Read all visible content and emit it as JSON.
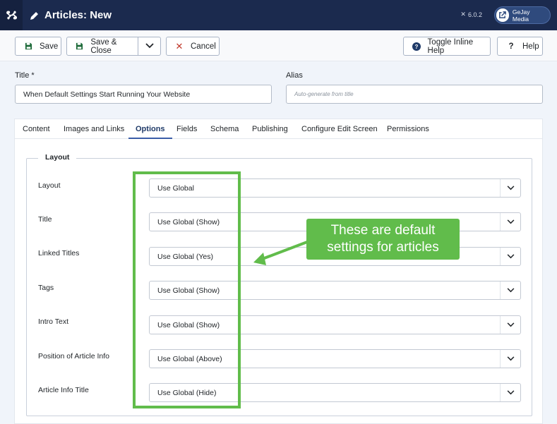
{
  "header": {
    "title": "Articles: New",
    "version": "6.0.2",
    "site_button": "GeJay Media"
  },
  "toolbar": {
    "save": "Save",
    "save_close": "Save & Close",
    "cancel": "Cancel",
    "toggle_help": "Toggle Inline Help",
    "help": "Help"
  },
  "form": {
    "title_label": "Title *",
    "title_value": "When Default Settings Start Running Your Website",
    "alias_label": "Alias",
    "alias_placeholder": "Auto-generate from title"
  },
  "tabs": [
    "Content",
    "Images and Links",
    "Options",
    "Fields",
    "Schema",
    "Publishing",
    "Configure Edit Screen",
    "Permissions"
  ],
  "active_tab": "Options",
  "fieldset": {
    "legend": "Layout",
    "rows": [
      {
        "label": "Layout",
        "value": "Use Global"
      },
      {
        "label": "Title",
        "value": "Use Global (Show)"
      },
      {
        "label": "Linked Titles",
        "value": "Use Global (Yes)"
      },
      {
        "label": "Tags",
        "value": "Use Global (Show)"
      },
      {
        "label": "Intro Text",
        "value": "Use Global (Show)"
      },
      {
        "label": "Position of Article Info",
        "value": "Use Global (Above)"
      },
      {
        "label": "Article Info Title",
        "value": "Use Global (Hide)"
      }
    ]
  },
  "annotation": {
    "line1": "These are default",
    "line2": "settings for articles",
    "color": "#61bc4b"
  },
  "colors": {
    "header_bg": "#1b2a4e",
    "active_tab": "#1f3a68"
  }
}
